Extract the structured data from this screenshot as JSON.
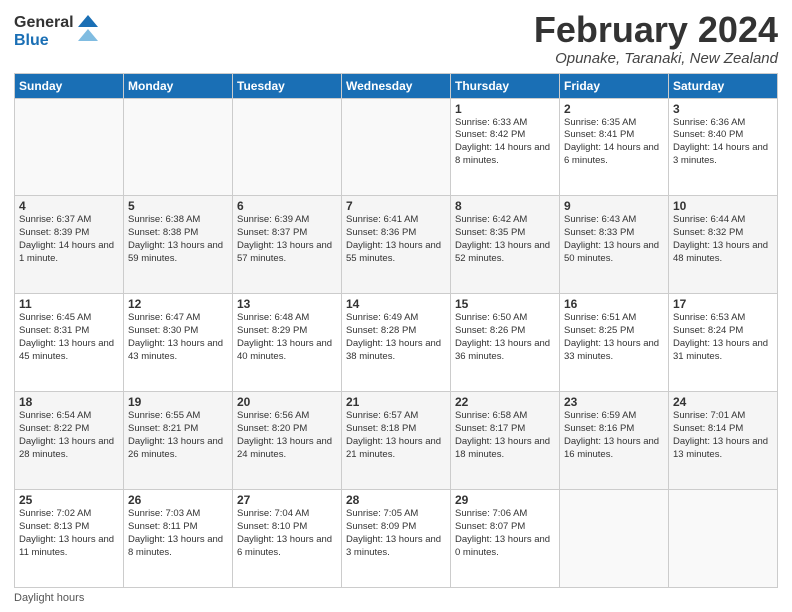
{
  "header": {
    "logo_general": "General",
    "logo_blue": "Blue",
    "title": "February 2024",
    "subtitle": "Opunake, Taranaki, New Zealand"
  },
  "footer": {
    "daylight_label": "Daylight hours"
  },
  "days": [
    "Sunday",
    "Monday",
    "Tuesday",
    "Wednesday",
    "Thursday",
    "Friday",
    "Saturday"
  ],
  "weeks": [
    [
      {
        "date": "",
        "info": ""
      },
      {
        "date": "",
        "info": ""
      },
      {
        "date": "",
        "info": ""
      },
      {
        "date": "",
        "info": ""
      },
      {
        "date": "1",
        "info": "Sunrise: 6:33 AM\nSunset: 8:42 PM\nDaylight: 14 hours and 8 minutes."
      },
      {
        "date": "2",
        "info": "Sunrise: 6:35 AM\nSunset: 8:41 PM\nDaylight: 14 hours and 6 minutes."
      },
      {
        "date": "3",
        "info": "Sunrise: 6:36 AM\nSunset: 8:40 PM\nDaylight: 14 hours and 3 minutes."
      }
    ],
    [
      {
        "date": "4",
        "info": "Sunrise: 6:37 AM\nSunset: 8:39 PM\nDaylight: 14 hours and 1 minute."
      },
      {
        "date": "5",
        "info": "Sunrise: 6:38 AM\nSunset: 8:38 PM\nDaylight: 13 hours and 59 minutes."
      },
      {
        "date": "6",
        "info": "Sunrise: 6:39 AM\nSunset: 8:37 PM\nDaylight: 13 hours and 57 minutes."
      },
      {
        "date": "7",
        "info": "Sunrise: 6:41 AM\nSunset: 8:36 PM\nDaylight: 13 hours and 55 minutes."
      },
      {
        "date": "8",
        "info": "Sunrise: 6:42 AM\nSunset: 8:35 PM\nDaylight: 13 hours and 52 minutes."
      },
      {
        "date": "9",
        "info": "Sunrise: 6:43 AM\nSunset: 8:33 PM\nDaylight: 13 hours and 50 minutes."
      },
      {
        "date": "10",
        "info": "Sunrise: 6:44 AM\nSunset: 8:32 PM\nDaylight: 13 hours and 48 minutes."
      }
    ],
    [
      {
        "date": "11",
        "info": "Sunrise: 6:45 AM\nSunset: 8:31 PM\nDaylight: 13 hours and 45 minutes."
      },
      {
        "date": "12",
        "info": "Sunrise: 6:47 AM\nSunset: 8:30 PM\nDaylight: 13 hours and 43 minutes."
      },
      {
        "date": "13",
        "info": "Sunrise: 6:48 AM\nSunset: 8:29 PM\nDaylight: 13 hours and 40 minutes."
      },
      {
        "date": "14",
        "info": "Sunrise: 6:49 AM\nSunset: 8:28 PM\nDaylight: 13 hours and 38 minutes."
      },
      {
        "date": "15",
        "info": "Sunrise: 6:50 AM\nSunset: 8:26 PM\nDaylight: 13 hours and 36 minutes."
      },
      {
        "date": "16",
        "info": "Sunrise: 6:51 AM\nSunset: 8:25 PM\nDaylight: 13 hours and 33 minutes."
      },
      {
        "date": "17",
        "info": "Sunrise: 6:53 AM\nSunset: 8:24 PM\nDaylight: 13 hours and 31 minutes."
      }
    ],
    [
      {
        "date": "18",
        "info": "Sunrise: 6:54 AM\nSunset: 8:22 PM\nDaylight: 13 hours and 28 minutes."
      },
      {
        "date": "19",
        "info": "Sunrise: 6:55 AM\nSunset: 8:21 PM\nDaylight: 13 hours and 26 minutes."
      },
      {
        "date": "20",
        "info": "Sunrise: 6:56 AM\nSunset: 8:20 PM\nDaylight: 13 hours and 24 minutes."
      },
      {
        "date": "21",
        "info": "Sunrise: 6:57 AM\nSunset: 8:18 PM\nDaylight: 13 hours and 21 minutes."
      },
      {
        "date": "22",
        "info": "Sunrise: 6:58 AM\nSunset: 8:17 PM\nDaylight: 13 hours and 18 minutes."
      },
      {
        "date": "23",
        "info": "Sunrise: 6:59 AM\nSunset: 8:16 PM\nDaylight: 13 hours and 16 minutes."
      },
      {
        "date": "24",
        "info": "Sunrise: 7:01 AM\nSunset: 8:14 PM\nDaylight: 13 hours and 13 minutes."
      }
    ],
    [
      {
        "date": "25",
        "info": "Sunrise: 7:02 AM\nSunset: 8:13 PM\nDaylight: 13 hours and 11 minutes."
      },
      {
        "date": "26",
        "info": "Sunrise: 7:03 AM\nSunset: 8:11 PM\nDaylight: 13 hours and 8 minutes."
      },
      {
        "date": "27",
        "info": "Sunrise: 7:04 AM\nSunset: 8:10 PM\nDaylight: 13 hours and 6 minutes."
      },
      {
        "date": "28",
        "info": "Sunrise: 7:05 AM\nSunset: 8:09 PM\nDaylight: 13 hours and 3 minutes."
      },
      {
        "date": "29",
        "info": "Sunrise: 7:06 AM\nSunset: 8:07 PM\nDaylight: 13 hours and 0 minutes."
      },
      {
        "date": "",
        "info": ""
      },
      {
        "date": "",
        "info": ""
      }
    ]
  ]
}
